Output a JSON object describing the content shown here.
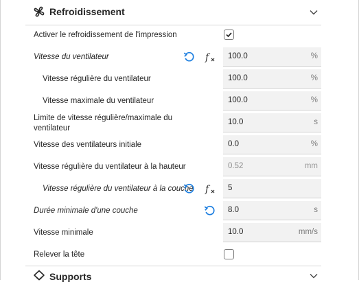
{
  "sections": {
    "cooling": {
      "title": "Refroidissement",
      "icon": "fan-icon"
    },
    "supports": {
      "title": "Supports",
      "icon": "support-icon"
    }
  },
  "rows": [
    {
      "label": "Activer le refroidissement de l'impression",
      "type": "checkbox",
      "checked": true
    },
    {
      "label": "Vitesse du ventilateur",
      "value": "100.0",
      "unit": "%"
    },
    {
      "label": "Vitesse régulière du ventilateur",
      "value": "100.0",
      "unit": "%"
    },
    {
      "label": "Vitesse maximale du ventilateur",
      "value": "100.0",
      "unit": "%"
    },
    {
      "label": "Limite de vitesse régulière/maximale du ventilateur",
      "value": "10.0",
      "unit": "s"
    },
    {
      "label": "Vitesse des ventilateurs initiale",
      "value": "0.0",
      "unit": "%"
    },
    {
      "label": "Vitesse régulière du ventilateur à la hauteur",
      "value": "0.52",
      "unit": "mm",
      "disabled": true
    },
    {
      "label": "Vitesse régulière du ventilateur à la couche",
      "value": "5",
      "unit": ""
    },
    {
      "label": "Durée minimale d'une couche",
      "value": "8.0",
      "unit": "s"
    },
    {
      "label": "Vitesse minimale",
      "value": "10.0",
      "unit": "mm/s"
    },
    {
      "label": "Relever la tête",
      "type": "checkbox",
      "checked": false
    }
  ],
  "colors": {
    "accent": "#1d7fe0",
    "field_bg": "#f2f2f2",
    "divider": "#d6d6d6"
  }
}
